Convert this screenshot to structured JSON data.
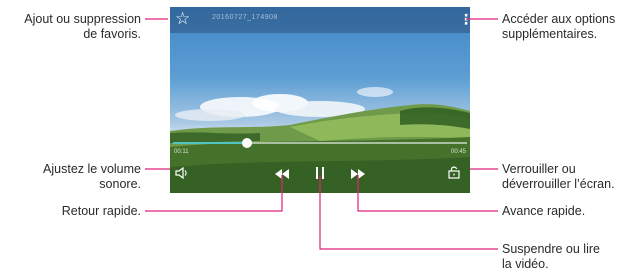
{
  "video": {
    "title": "20160727_174908",
    "time_elapsed": "00:11",
    "time_total": "00:45",
    "progress": 0.25
  },
  "icons": {
    "favorite": "star-outline-icon",
    "more": "more-vertical-icon",
    "volume": "volume-icon",
    "rewind": "rewind-icon",
    "pause": "pause-icon",
    "fast_forward": "fast-forward-icon",
    "lock": "lock-icon"
  },
  "callouts": {
    "favorites": [
      "Ajout ou suppression",
      "de favoris."
    ],
    "options": [
      "Accéder aux options",
      "supplémentaires."
    ],
    "volume": [
      "Ajustez le volume",
      "sonore."
    ],
    "lock": [
      "Verrouiller ou",
      "déverrouiller l’écran."
    ],
    "rewind": [
      "Retour rapide."
    ],
    "fast_forward": [
      "Avance rapide."
    ],
    "pause": [
      "Suspendre ou lire",
      "la vidéo."
    ]
  },
  "colors": {
    "accent": "#4ec5c1",
    "callout_line": "#e0207a"
  }
}
